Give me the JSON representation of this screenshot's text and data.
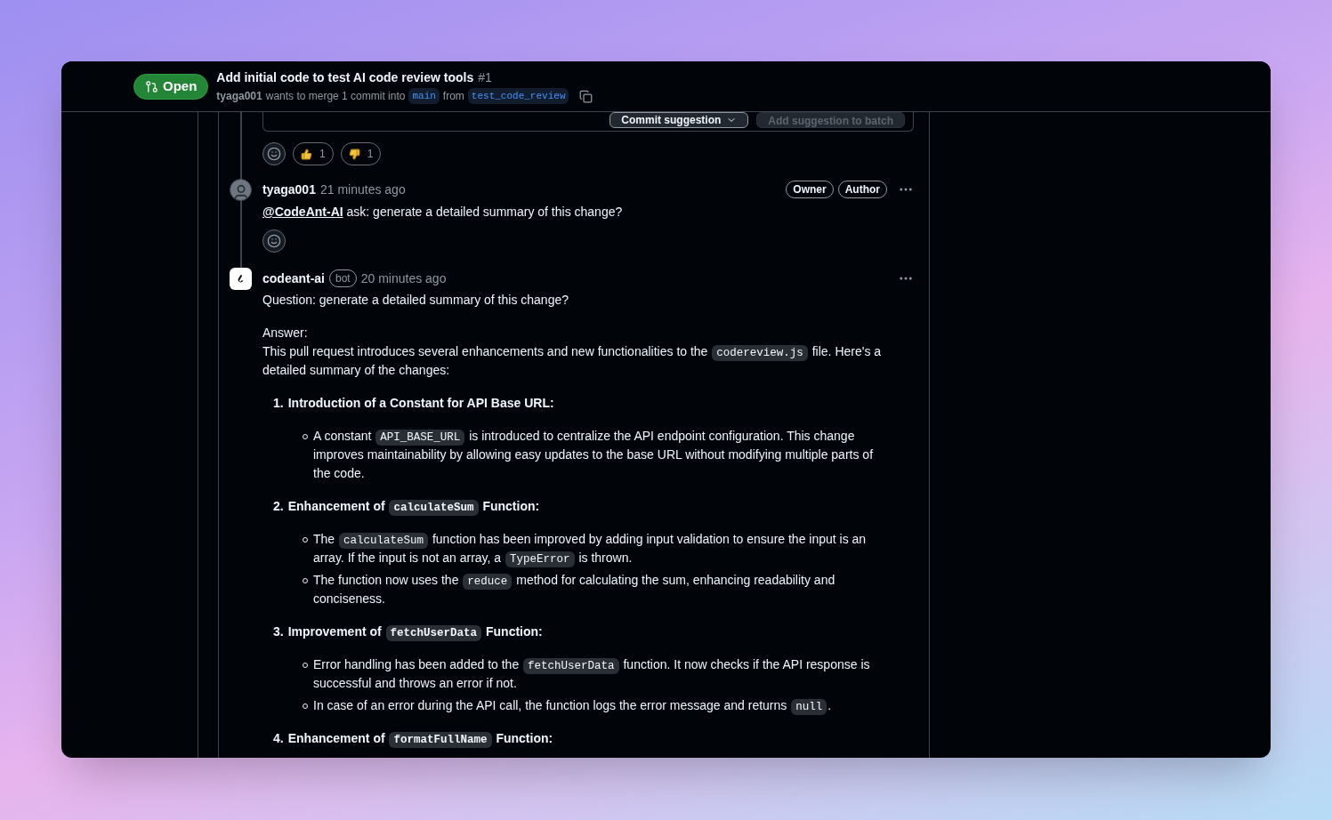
{
  "header": {
    "status": "Open",
    "title": "Add initial code to test AI code review tools",
    "number": "#1",
    "author": "tyaga001",
    "merge_text": "wants to merge 1 commit into",
    "base_branch": "main",
    "from_text": "from",
    "head_branch": "test_code_review"
  },
  "suggestion_buttons": [
    {
      "label": "Commit suggestion",
      "disabled": false
    },
    {
      "label": "Add suggestion to batch",
      "disabled": true
    }
  ],
  "reactions": [
    {
      "kind": "thumbs_up",
      "count": "1"
    },
    {
      "kind": "thumbs_down",
      "count": "1"
    }
  ],
  "comments": [
    {
      "kind": "user",
      "author": "tyaga001",
      "time": "21 minutes ago",
      "badges": [
        "Owner",
        "Author"
      ],
      "mention": "@CodeAnt-AI",
      "text": " ask: generate a detailed summary of this change?"
    },
    {
      "kind": "bot",
      "author": "codeant-ai",
      "bot_label": "bot",
      "time": "20 minutes ago",
      "question": "Question: generate a detailed summary of this change?",
      "answer_label": "Answer:",
      "intro": [
        {
          "text": "This pull request introduces several enhancements and new functionalities to the "
        },
        {
          "code": "codereview.js"
        },
        {
          "text": " file. Here's a detailed summary of the changes:"
        }
      ],
      "items": [
        {
          "number": "1.",
          "title": [
            {
              "text": "Introduction of a Constant for API Base URL:"
            }
          ],
          "bullets": [
            [
              {
                "text": "A constant "
              },
              {
                "code": "API_BASE_URL"
              },
              {
                "text": " is introduced to centralize the API endpoint configuration. This change improves maintainability by allowing easy updates to the base URL without modifying multiple parts of the code."
              }
            ]
          ]
        },
        {
          "number": "2.",
          "title": [
            {
              "text": "Enhancement of "
            },
            {
              "code": "calculateSum"
            },
            {
              "text": " Function:"
            }
          ],
          "bullets": [
            [
              {
                "text": "The "
              },
              {
                "code": "calculateSum"
              },
              {
                "text": " function has been improved by adding input validation to ensure the input is an array. If the input is not an array, a "
              },
              {
                "code": "TypeError"
              },
              {
                "text": " is thrown."
              }
            ],
            [
              {
                "text": "The function now uses the "
              },
              {
                "code": "reduce"
              },
              {
                "text": " method for calculating the sum, enhancing readability and conciseness."
              }
            ]
          ]
        },
        {
          "number": "3.",
          "title": [
            {
              "text": "Improvement of "
            },
            {
              "code": "fetchUserData"
            },
            {
              "text": " Function:"
            }
          ],
          "bullets": [
            [
              {
                "text": "Error handling has been added to the "
              },
              {
                "code": "fetchUserData"
              },
              {
                "text": " function. It now checks if the API response is successful and throws an error if not."
              }
            ],
            [
              {
                "text": "In case of an error during the API call, the function logs the error message and returns "
              },
              {
                "code": "null"
              },
              {
                "text": "."
              }
            ]
          ]
        },
        {
          "number": "4.",
          "title": [
            {
              "text": "Enhancement of "
            },
            {
              "code": "formatFullName"
            },
            {
              "text": " Function:"
            }
          ]
        }
      ]
    }
  ]
}
